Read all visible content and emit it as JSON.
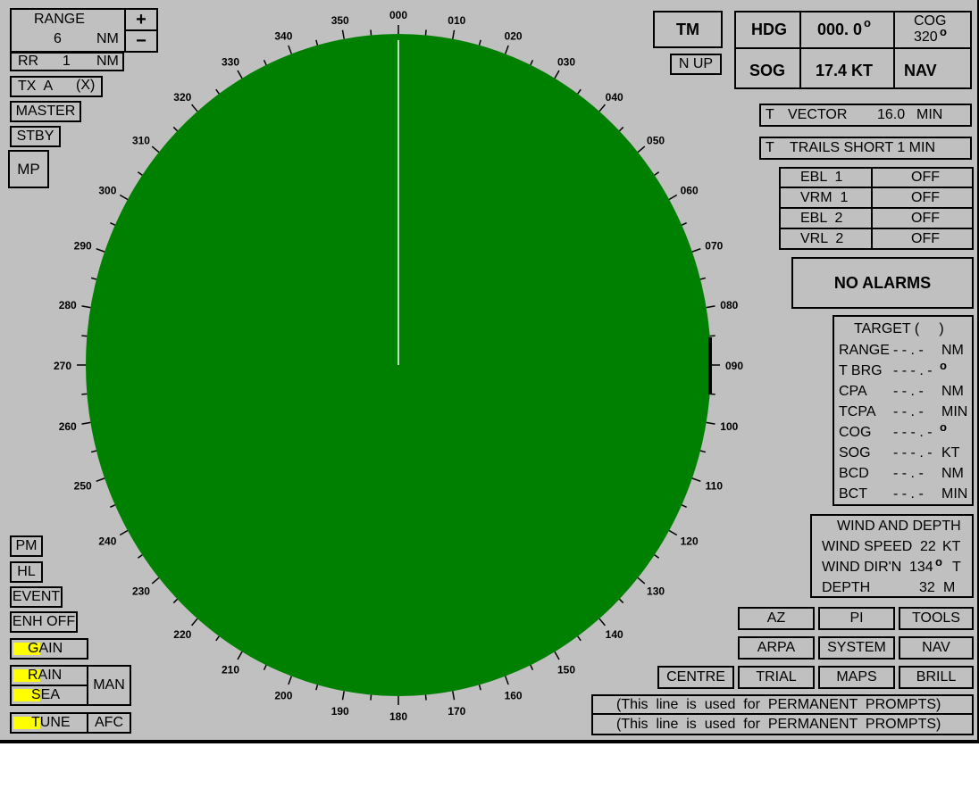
{
  "range": {
    "label": "RANGE",
    "value": "6",
    "unit": "NM",
    "plus": "+",
    "minus": "−"
  },
  "rings": {
    "label": "RR",
    "value": "1",
    "unit": "NM"
  },
  "tx": {
    "label": "TX  A",
    "mark": "(X)"
  },
  "master_label": "MASTER",
  "stby_label": "STBY",
  "mp_label": "MP",
  "left_buttons": {
    "pm": "PM",
    "hl": "HL",
    "event": "EVENT",
    "enh": "ENH OFF"
  },
  "controls": {
    "gain": "GAIN",
    "rain": "RAIN",
    "sea": "SEA",
    "tune": "TUNE",
    "man": "MAN",
    "afc": "AFC"
  },
  "motion_mode": "TM",
  "orientation": "N UP",
  "nav_data": {
    "hdg_label": "HDG",
    "hdg_value": "000. 0",
    "deg": "o",
    "cog_label": "COG",
    "cog_value": "320",
    "sog_label": "SOG",
    "sog_value": "17.4 KT",
    "nav_label": "NAV"
  },
  "vector": {
    "mode": "T",
    "label": "VECTOR",
    "value": "16.0",
    "unit": "MIN"
  },
  "trails": {
    "mode": "T",
    "text": "TRAILS SHORT 1 MIN"
  },
  "ebl_vrm": [
    {
      "label": "EBL  1",
      "state": "OFF"
    },
    {
      "label": "VRM  1",
      "state": "OFF"
    },
    {
      "label": "EBL  2",
      "state": "OFF"
    },
    {
      "label": "VRL  2",
      "state": "OFF"
    }
  ],
  "alarm": "NO ALARMS",
  "target": {
    "title": "TARGET (     )",
    "rows": [
      {
        "label": "RANGE",
        "value": "- - . -",
        "unit": "NM"
      },
      {
        "label": "T BRG",
        "value": "- - - . -",
        "unit": "o"
      },
      {
        "label": "CPA",
        "value": "- - . -",
        "unit": "NM"
      },
      {
        "label": "TCPA",
        "value": "- - . -",
        "unit": "MIN"
      },
      {
        "label": "COG",
        "value": "- - - . -",
        "unit": "o"
      },
      {
        "label": "SOG",
        "value": "- - - . -",
        "unit": "KT"
      },
      {
        "label": "BCD",
        "value": "- - . -",
        "unit": "NM"
      },
      {
        "label": "BCT",
        "value": "- - . -",
        "unit": "MIN"
      }
    ]
  },
  "wind_depth": {
    "title": "WIND AND DEPTH",
    "speed_label": "WIND SPEED",
    "speed_value": "22",
    "speed_unit": "KT",
    "dir_label": "WIND DIR'N",
    "dir_value": "134",
    "dir_ref": "T",
    "depth_label": "DEPTH",
    "depth_value": "32",
    "depth_unit": "M"
  },
  "menu": {
    "az": "AZ",
    "pi": "PI",
    "tools": "TOOLS",
    "arpa": "ARPA",
    "system": "SYSTEM",
    "nav": "NAV",
    "centre": "CENTRE",
    "trial": "TRIAL",
    "maps": "MAPS",
    "brill": "BRILL"
  },
  "prompts": [
    "(This  line  is  used  for  PERMANENT  PROMPTS)",
    "(This  line  is  used  for  PERMANENT  PROMPTS)"
  ],
  "bearing_labels": [
    "000",
    "010",
    "020",
    "030",
    "040",
    "050",
    "060",
    "070",
    "080",
    "090",
    "100",
    "110",
    "120",
    "130",
    "140",
    "150",
    "160",
    "170",
    "180",
    "190",
    "200",
    "210",
    "220",
    "230",
    "240",
    "250",
    "260",
    "270",
    "280",
    "290",
    "300",
    "310",
    "320",
    "330",
    "340",
    "350"
  ],
  "colors": {
    "scope": "#008000",
    "background": "#c0c0c0",
    "control_fill": "#ffff00",
    "heading_line": "#ffffff"
  }
}
